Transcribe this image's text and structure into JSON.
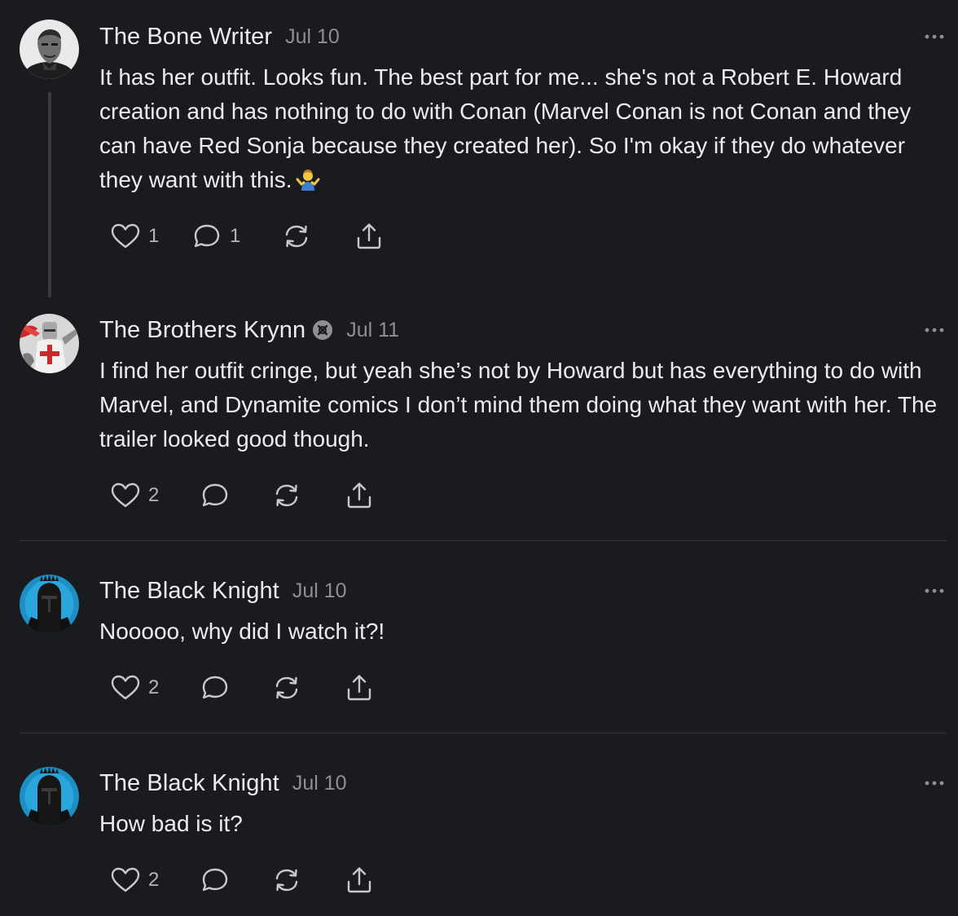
{
  "posts": [
    {
      "author": "The Bone Writer",
      "date": "Jul 10",
      "avatar": "man-portrait-avatar",
      "badge": null,
      "text": "It has her outfit. Looks fun. The best part for me... she's not a Robert E. Howard creation and has nothing to do with Conan (Marvel Conan is not Conan and they can have Red Sonja because they created her). So I'm okay if they do whatever they want with this.",
      "emoji": "person-shrugging",
      "likes": "1",
      "replies": "1"
    },
    {
      "author": "The Brothers Krynn",
      "date": "Jul 11",
      "avatar": "knight-templar-avatar",
      "badge": "verified-creator-icon",
      "text": "I find her outfit cringe, but yeah she’s not by Howard but has everything to do with Marvel, and Dynamite comics I don’t mind them doing what they want with her. The trailer looked good though.",
      "likes": "2",
      "replies": ""
    },
    {
      "author": "The Black Knight",
      "date": "Jul 10",
      "avatar": "black-knight-helmet-avatar",
      "text": "Nooooo, why did I watch it?!",
      "likes": "2",
      "replies": ""
    },
    {
      "author": "The Black Knight",
      "date": "Jul 10",
      "avatar": "black-knight-helmet-avatar",
      "text": "How bad is it?",
      "likes": "2",
      "replies": ""
    }
  ],
  "icons": {
    "like": "heart-icon",
    "reply": "comment-bubble-icon",
    "restack": "restack-arrows-icon",
    "share": "share-upload-icon",
    "more": "more-dots-icon"
  },
  "colors": {
    "background": "#1a1b1e",
    "text": "#ececee",
    "muted": "#8e8f94",
    "divider": "#36373b",
    "knight_avatar_bg": "#1c8fc4"
  }
}
